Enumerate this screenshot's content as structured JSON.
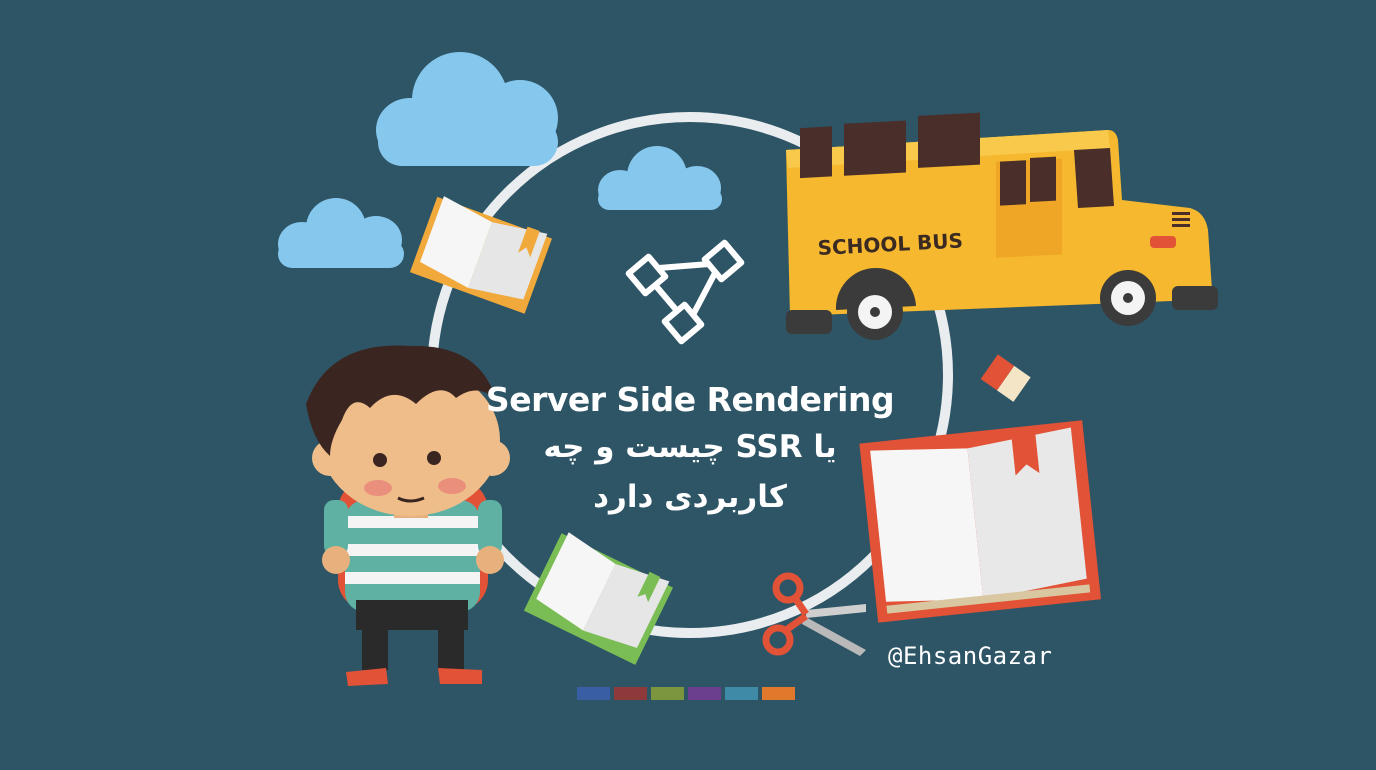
{
  "title": {
    "line1": "Server Side Rendering",
    "line2": "یا SSR چیست و چه",
    "line3": "کاربردی دارد"
  },
  "bus_label": "SCHOOL BUS",
  "handle": "@EhsanGazar",
  "icons": [
    "cloud-icon",
    "open-book-icon",
    "sitemap-icon",
    "school-bus-icon",
    "eraser-icon",
    "scissors-icon",
    "boy-character",
    "color-swatches"
  ],
  "colors": {
    "background": "#2e5566",
    "ring": "#e9edef",
    "cloud": "#86c7ee",
    "bus": "#f5b82e",
    "book_orange": "#f0a93a",
    "book_red": "#e15236",
    "book_green": "#7bbd55"
  },
  "swatches": [
    "#3a5ea4",
    "#8e3a3a",
    "#7b963f",
    "#6b3f8e",
    "#3f8aa6",
    "#e0792b"
  ]
}
